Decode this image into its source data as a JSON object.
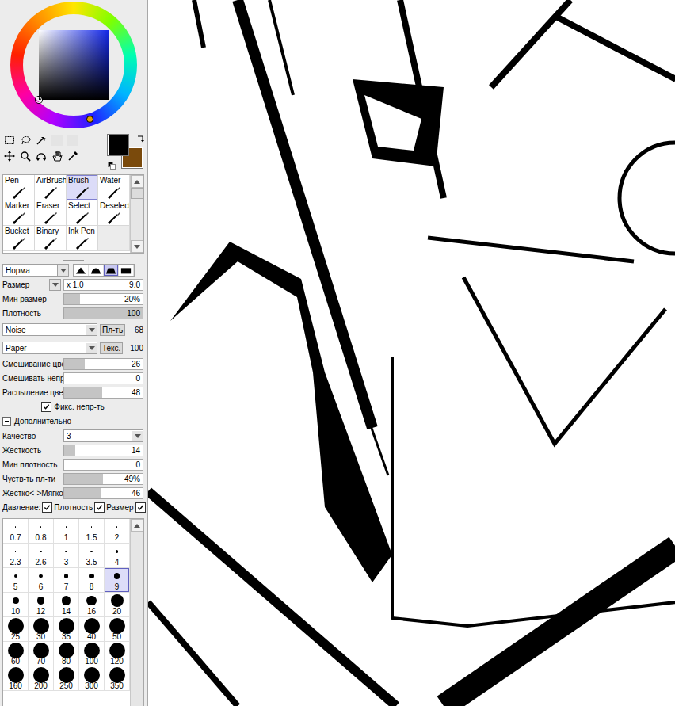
{
  "color_picker": {
    "primary_color": "#000000",
    "secondary_color": "#7a4a0c"
  },
  "tools": [
    {
      "label": "Pen",
      "selected": false
    },
    {
      "label": "AirBrush",
      "selected": false
    },
    {
      "label": "Brush",
      "selected": true
    },
    {
      "label": "Water",
      "selected": false
    },
    {
      "label": "Marker",
      "selected": false
    },
    {
      "label": "Eraser",
      "selected": false
    },
    {
      "label": "Select",
      "selected": false
    },
    {
      "label": "Deselect",
      "selected": false
    },
    {
      "label": "Bucket",
      "selected": false
    },
    {
      "label": "Binary",
      "selected": false
    },
    {
      "label": "Ink Pen",
      "selected": false
    }
  ],
  "blend_mode": "Норма",
  "shape_buttons": [
    {
      "kind": "peak",
      "selected": false
    },
    {
      "kind": "bump",
      "selected": false
    },
    {
      "kind": "flat",
      "selected": true
    },
    {
      "kind": "square",
      "selected": false
    }
  ],
  "size": {
    "label": "Размер",
    "multiplier": "x 1.0",
    "value": "9.0"
  },
  "sliders": [
    {
      "label": "Мин размер",
      "reading": "20%",
      "level": 0.2
    },
    {
      "label": "Плотность",
      "reading": "100",
      "level": 1.0
    }
  ],
  "textures": [
    {
      "value": "Noise",
      "tag": "Пл-ть",
      "reading": "68"
    },
    {
      "value": "Paper",
      "tag": "Текс.",
      "reading": "100"
    }
  ],
  "mix_sliders": [
    {
      "label": "Смешивание цвет",
      "reading": "26",
      "level": 0.26
    },
    {
      "label": "Смешивать непро",
      "reading": "0",
      "level": 0
    },
    {
      "label": "Распыление цвет",
      "reading": "48",
      "level": 0.48
    }
  ],
  "fix_opacity": {
    "label": "Фикс. непр-ть",
    "checked": true
  },
  "advanced": {
    "label": "Дополнительно",
    "expanded": true
  },
  "quality": {
    "label": "Качество",
    "value": "3"
  },
  "advanced_sliders": [
    {
      "label": "Жесткость",
      "reading": "14",
      "level": 0.14
    },
    {
      "label": "Мин плотность",
      "reading": "0",
      "level": 0
    },
    {
      "label": "Чуств-ть пл-ти",
      "reading": "49%",
      "level": 0.49
    },
    {
      "label": "Жестко<->Мягко",
      "reading": "46",
      "level": 0.46
    }
  ],
  "pressure": {
    "label": "Давление:",
    "items": [
      {
        "label": "Плотность",
        "checked": true
      },
      {
        "label": "Размер",
        "checked": true
      },
      {
        "label": "",
        "checked": true
      }
    ]
  },
  "brush_sizes": [
    {
      "label": "0.7",
      "selected": false
    },
    {
      "label": "0.8",
      "selected": false
    },
    {
      "label": "1",
      "selected": false
    },
    {
      "label": "1.5",
      "selected": false
    },
    {
      "label": "2",
      "selected": false
    },
    {
      "label": "2.3",
      "selected": false
    },
    {
      "label": "2.6",
      "selected": false
    },
    {
      "label": "3",
      "selected": false
    },
    {
      "label": "3.5",
      "selected": false
    },
    {
      "label": "4",
      "selected": false
    },
    {
      "label": "5",
      "selected": false
    },
    {
      "label": "6",
      "selected": false
    },
    {
      "label": "7",
      "selected": false
    },
    {
      "label": "8",
      "selected": false
    },
    {
      "label": "9",
      "selected": true
    },
    {
      "label": "10",
      "selected": false
    },
    {
      "label": "12",
      "selected": false
    },
    {
      "label": "14",
      "selected": false
    },
    {
      "label": "16",
      "selected": false
    },
    {
      "label": "20",
      "selected": false
    },
    {
      "label": "25",
      "selected": false
    },
    {
      "label": "30",
      "selected": false
    },
    {
      "label": "35",
      "selected": false
    },
    {
      "label": "40",
      "selected": false
    },
    {
      "label": "50",
      "selected": false
    },
    {
      "label": "60",
      "selected": false
    },
    {
      "label": "70",
      "selected": false
    },
    {
      "label": "80",
      "selected": false
    },
    {
      "label": "100",
      "selected": false
    },
    {
      "label": "120",
      "selected": false
    },
    {
      "label": "160",
      "selected": false
    },
    {
      "label": "200",
      "selected": false
    },
    {
      "label": "250",
      "selected": false
    },
    {
      "label": "300",
      "selected": false
    },
    {
      "label": "350",
      "selected": false
    }
  ]
}
